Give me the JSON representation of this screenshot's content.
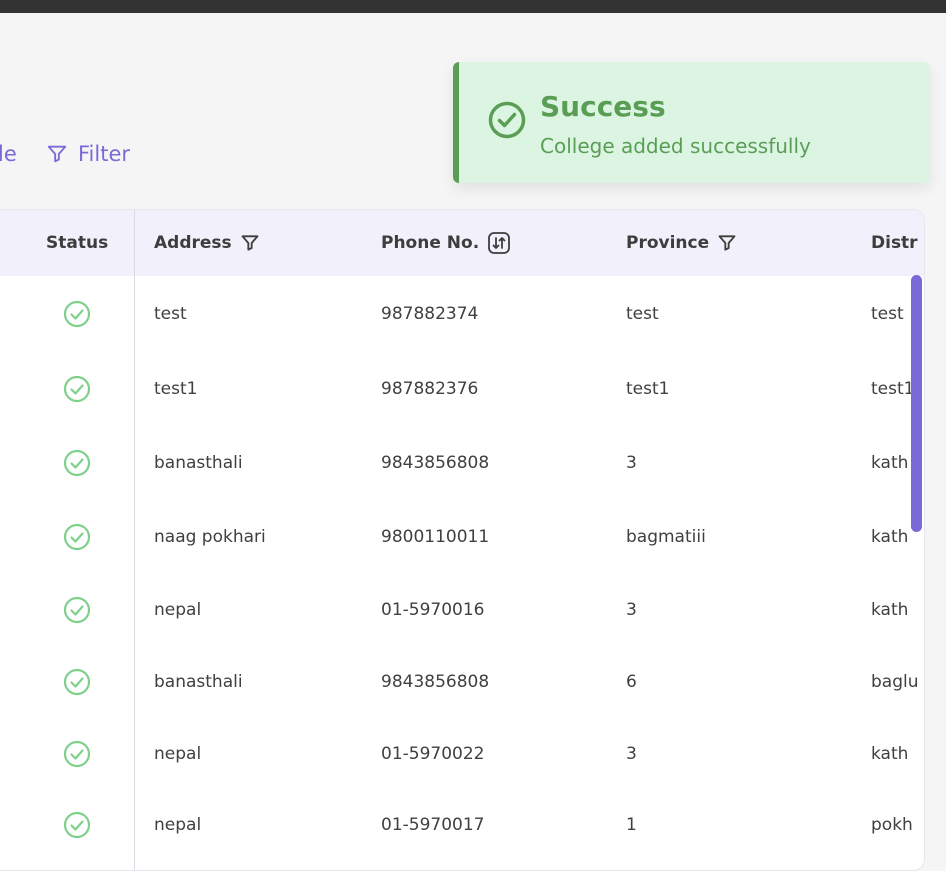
{
  "toolbar": {
    "cut_label": "le",
    "filter_label": "Filter"
  },
  "table": {
    "columns": {
      "status": "Status",
      "address": "Address",
      "phone": "Phone No.",
      "province": "Province",
      "district": "Distr"
    },
    "rows": [
      {
        "address": "test",
        "phone": "987882374",
        "province": "test",
        "district": "test"
      },
      {
        "address": "test1",
        "phone": "987882376",
        "province": "test1",
        "district": "test1"
      },
      {
        "address": "banasthali",
        "phone": "9843856808",
        "province": "3",
        "district": "kath"
      },
      {
        "address": "naag pokhari",
        "phone": "9800110011",
        "province": "bagmatiii",
        "district": "kath"
      },
      {
        "address": "nepal",
        "phone": "01-5970016",
        "province": "3",
        "district": "kath"
      },
      {
        "address": "banasthali",
        "phone": "9843856808",
        "province": "6",
        "district": "baglu"
      },
      {
        "address": "nepal",
        "phone": "01-5970022",
        "province": "3",
        "district": "kath"
      },
      {
        "address": "nepal",
        "phone": "01-5970017",
        "province": "1",
        "district": "pokh"
      }
    ]
  },
  "toast": {
    "title": "Success",
    "message": "College added successfully"
  },
  "colors": {
    "accent": "#7a6ad8",
    "success": "#5a9e55",
    "status_icon": "#7ed08a",
    "toast_bg": "#dcf5e3"
  },
  "icons": {
    "filter": "filter-icon",
    "sort": "sort-icon",
    "status": "check-circle-icon"
  }
}
